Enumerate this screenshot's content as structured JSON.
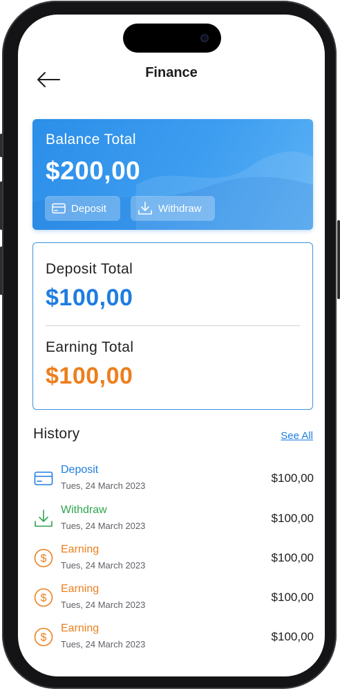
{
  "header": {
    "title": "Finance"
  },
  "balance": {
    "label": "Balance Total",
    "value": "$200,00",
    "deposit_label": "Deposit",
    "withdraw_label": "Withdraw"
  },
  "totals": {
    "deposit_label": "Deposit Total",
    "deposit_value": "$100,00",
    "earning_label": "Earning Total",
    "earning_value": "$100,00"
  },
  "history": {
    "title": "History",
    "see_all": "See All",
    "items": [
      {
        "type": "Deposit",
        "date": "Tues, 24 March 2023",
        "amount": "$100,00",
        "icon": "card-icon",
        "color": "#1e7de0"
      },
      {
        "type": "Withdraw",
        "date": "Tues, 24 March 2023",
        "amount": "$100,00",
        "icon": "download-icon",
        "color": "#2ea44f"
      },
      {
        "type": "Earning",
        "date": "Tues, 24 March 2023",
        "amount": "$100,00",
        "icon": "dollar-icon",
        "color": "#ec7f1d"
      },
      {
        "type": "Earning",
        "date": "Tues, 24 March 2023",
        "amount": "$100,00",
        "icon": "dollar-icon",
        "color": "#ec7f1d"
      },
      {
        "type": "Earning",
        "date": "Tues, 24 March 2023",
        "amount": "$100,00",
        "icon": "dollar-icon",
        "color": "#ec7f1d"
      }
    ]
  },
  "colors": {
    "accent": "#1e7de0",
    "earning": "#ec7f1d",
    "withdraw": "#2ea44f"
  }
}
